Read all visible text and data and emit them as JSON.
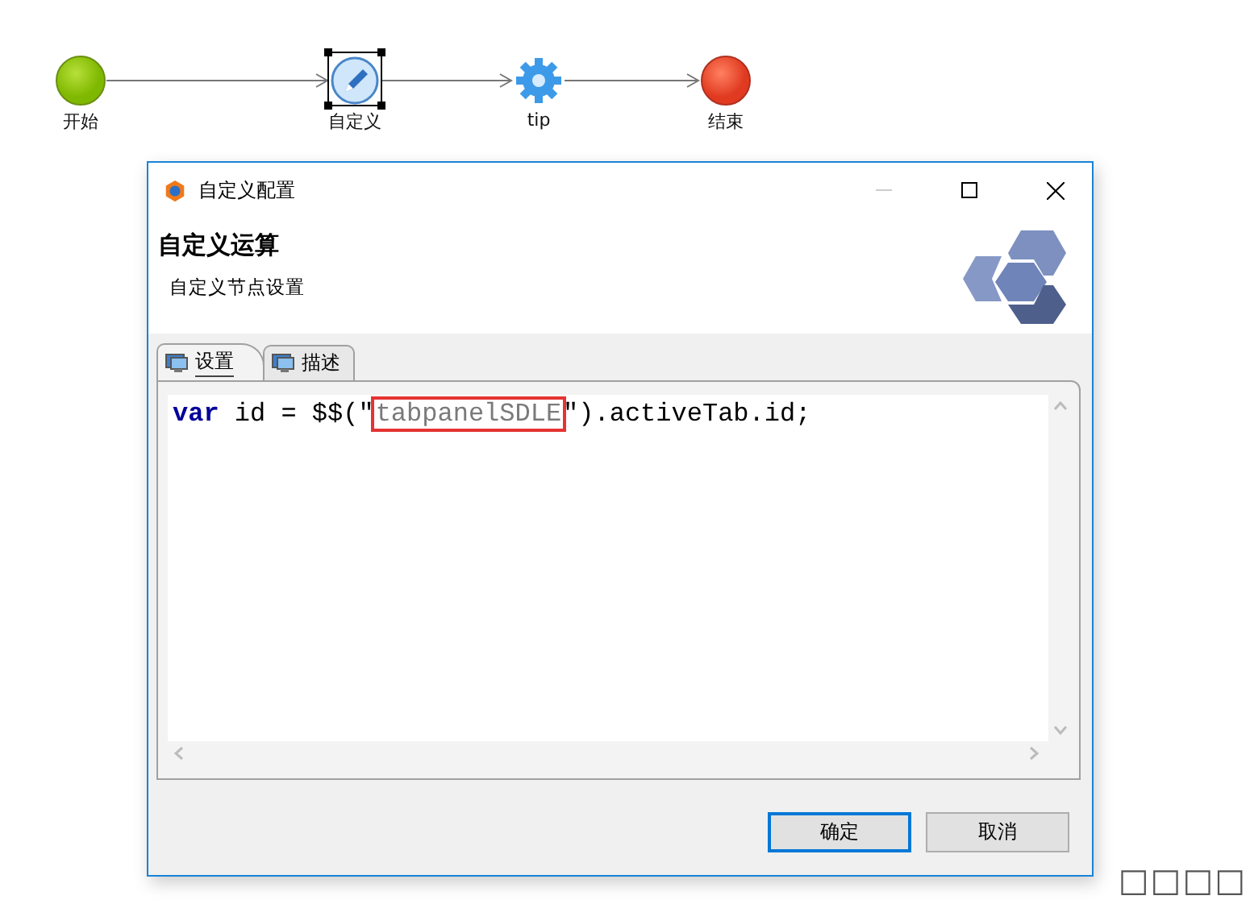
{
  "diagram": {
    "nodes": [
      {
        "kind": "start",
        "label": "开始",
        "selected": false
      },
      {
        "kind": "script",
        "label": "自定义",
        "selected": true
      },
      {
        "kind": "service",
        "label": "tip",
        "selected": false
      },
      {
        "kind": "end",
        "label": "结束",
        "selected": false
      }
    ]
  },
  "dialog": {
    "title": "自定义配置",
    "heading": "自定义运算",
    "description": "自定义节点设置",
    "tabs": [
      {
        "label": "设置",
        "selected": true
      },
      {
        "label": "描述",
        "selected": false
      }
    ],
    "code": [
      {
        "kind": "keyword",
        "text": "var",
        "highlighted": false
      },
      {
        "kind": "plain",
        "text": " id = $$(\"",
        "highlighted": false
      },
      {
        "kind": "string",
        "text": "tabpanelSDLE",
        "highlighted": true
      },
      {
        "kind": "plain",
        "text": "\").activeTab.id;",
        "highlighted": false
      }
    ],
    "buttons": [
      {
        "label": "确定",
        "default": true
      },
      {
        "label": "取消",
        "default": false
      }
    ]
  },
  "corner_text": "□□□□"
}
